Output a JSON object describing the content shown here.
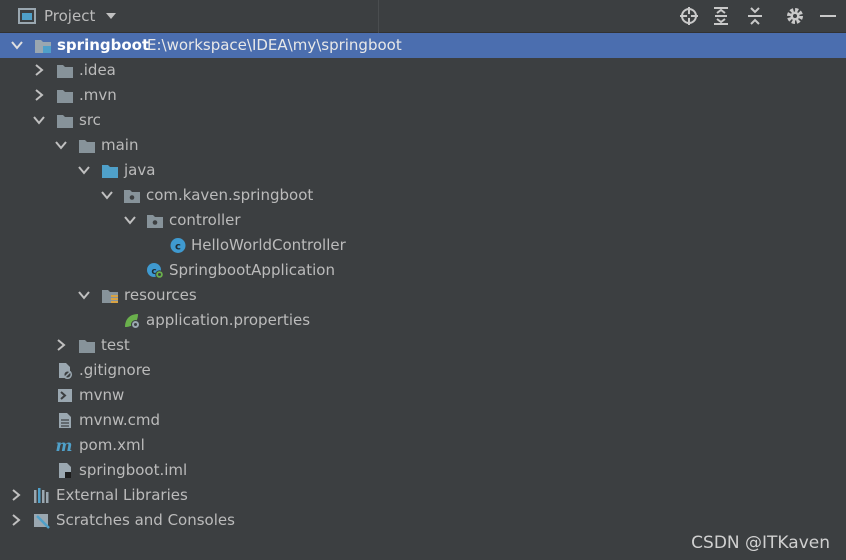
{
  "panel": {
    "title": "Project"
  },
  "tree": {
    "root_name": "springboot",
    "root_path": "E:\\workspace\\IDEA\\my\\springboot",
    "idea": ".idea",
    "mvn": ".mvn",
    "src": "src",
    "main": "main",
    "java": "java",
    "package": "com.kaven.springboot",
    "controller": "controller",
    "hello_controller": "HelloWorldController",
    "app_class": "SpringbootApplication",
    "resources": "resources",
    "app_props": "application.properties",
    "test": "test",
    "gitignore": ".gitignore",
    "mvnw": "mvnw",
    "mvnw_cmd": "mvnw.cmd",
    "pom": "pom.xml",
    "iml": "springboot.iml",
    "external_libs": "External Libraries",
    "scratches": "Scratches and Consoles"
  },
  "watermark": "CSDN @ITKaven",
  "colors": {
    "background": "#3c3f41",
    "selection": "#4b6eaf",
    "folder": "#87939a",
    "source_folder": "#4fa0c9"
  }
}
